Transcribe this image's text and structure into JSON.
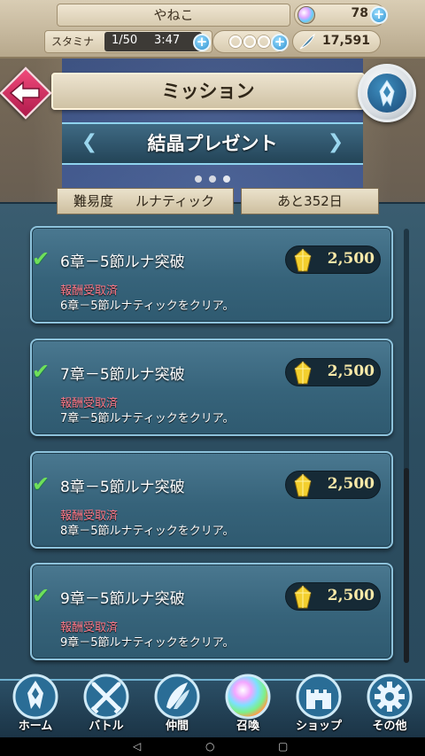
{
  "header_bar": {
    "player_name": "やねこ",
    "orbs": "78",
    "stamina_label": "スタミナ",
    "stamina": "1/50",
    "stamina_timer": "3:47",
    "feathers": "17,591"
  },
  "nav_header": {
    "title": "ミッション",
    "banner": "結晶プレゼント"
  },
  "info": {
    "difficulty_label": "難易度",
    "difficulty_value": "ルナティック",
    "remaining": "あと352日"
  },
  "missions": [
    {
      "title": "6章－5節ルナ突破",
      "status": "報酬受取済",
      "desc": "6章－5節ルナティックをクリア。",
      "reward": "2,500"
    },
    {
      "title": "7章－5節ルナ突破",
      "status": "報酬受取済",
      "desc": "7章－5節ルナティックをクリア。",
      "reward": "2,500"
    },
    {
      "title": "8章－5節ルナ突破",
      "status": "報酬受取済",
      "desc": "8章－5節ルナティックをクリア。",
      "reward": "2,500"
    },
    {
      "title": "9章－5節ルナ突破",
      "status": "報酬受取済",
      "desc": "9章－5節ルナティックをクリア。",
      "reward": "2,500"
    }
  ],
  "bottom_nav": [
    {
      "label": "ホーム",
      "icon": "home-emblem-icon"
    },
    {
      "label": "バトル",
      "icon": "crossed-swords-icon"
    },
    {
      "label": "仲間",
      "icon": "wings-icon"
    },
    {
      "label": "召喚",
      "icon": "orb-icon"
    },
    {
      "label": "ショップ",
      "icon": "castle-icon"
    },
    {
      "label": "その他",
      "icon": "gear-icon"
    }
  ],
  "colors": {
    "status_red": "#ff7a8a",
    "check_green": "#6fe05a",
    "reward_gold": "#f8e9a8",
    "back_button": "#e0336a"
  }
}
